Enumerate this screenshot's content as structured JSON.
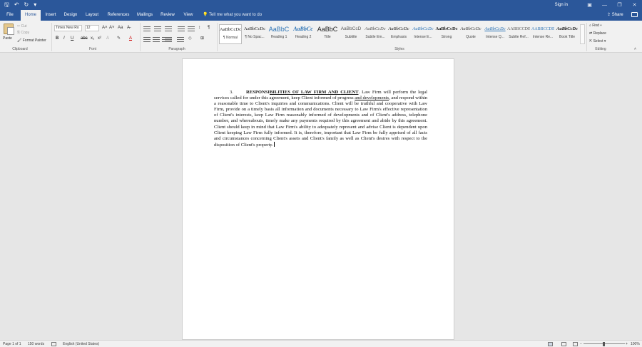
{
  "qat": {
    "save_icon": "save-icon",
    "undo_icon": "undo-icon",
    "redo_icon": "redo-icon"
  },
  "window": {
    "signin": "Sign in",
    "min": "—",
    "restore": "❐",
    "close": "✕"
  },
  "tabs": [
    "File",
    "Home",
    "Insert",
    "Design",
    "Layout",
    "References",
    "Mailings",
    "Review",
    "View"
  ],
  "tell_me": "Tell me what you want to do",
  "share": "Share",
  "clipboard": {
    "paste": "Paste",
    "cut": "Cut",
    "copy": "Copy",
    "format_painter": "Format Painter",
    "group": "Clipboard"
  },
  "font": {
    "family": "Times New Ro",
    "size": "12",
    "group": "Font",
    "grow": "A˄",
    "shrink": "A˅",
    "case": "Aa",
    "bold": "B",
    "italic": "I",
    "underline": "U",
    "strike": "abc",
    "sub": "x₂",
    "sup": "x²",
    "color": "A"
  },
  "paragraph": {
    "group": "Paragraph",
    "pilcrow": "¶"
  },
  "styles": {
    "group": "Styles",
    "items": [
      {
        "preview": "AaBbCcDc",
        "name": "¶ Normal"
      },
      {
        "preview": "AaBbCcDc",
        "name": "¶ No Spac..."
      },
      {
        "preview": "AaBbC",
        "name": "Heading 1"
      },
      {
        "preview": "AaBbCc",
        "name": "Heading 2"
      },
      {
        "preview": "AaBbC",
        "name": "Title"
      },
      {
        "preview": "AaBbCcD",
        "name": "Subtitle"
      },
      {
        "preview": "AaBbCcDc",
        "name": "Subtle Em..."
      },
      {
        "preview": "AaBbCcDc",
        "name": "Emphasis"
      },
      {
        "preview": "AaBbCcDc",
        "name": "Intense E..."
      },
      {
        "preview": "AaBbCcDc",
        "name": "Strong"
      },
      {
        "preview": "AaBbCcDc",
        "name": "Quote"
      },
      {
        "preview": "AaBbCcDc",
        "name": "Intense Q..."
      },
      {
        "preview": "AABBCCDE",
        "name": "Subtle Ref..."
      },
      {
        "preview": "AABBCCDE",
        "name": "Intense Re..."
      },
      {
        "preview": "AaBbCcDc",
        "name": "Book Title"
      }
    ]
  },
  "editing": {
    "find": "Find",
    "replace": "Replace",
    "select": "Select",
    "group": "Editing"
  },
  "document": {
    "number": "3.",
    "heading_part1": "RESPONSI",
    "heading_part2": "BILITIES OF LAW FIRM AND ",
    "heading_part3": "CLIENT",
    "sentence_start": ".  Law Firm will perform the legal services called for under this agreement, keep Client informed of progress ",
    "underlined_phrase": "and developments",
    "body": ", and respond within a reasonable time to Client's inquiries and communications.  Client will be truthful and cooperative with Law Firm, provide on a timely basis all information and documents necessary to Law Firm's effective representation of Client's interests, keep Law Firm reasonably informed of developments and of Client's address, telephone number, and whereabouts, timely make any payments required by this agreement and abide by this agreement.  Client should keep in mind that Law Firm's ability to adequately represent and advise Client is dependent upon Client keeping Law Firm fully informed.  It is, therefore, important that Law Firm be fully apprised of all facts and circumstances concerning Client's assets and Client's family as well as Client's desires with respect to the disposition of Client's property."
  },
  "status": {
    "page": "Page 1 of 1",
    "words": "150 words",
    "language": "English (United States)",
    "zoom": "100%",
    "minus": "−",
    "plus": "+"
  },
  "colors": {
    "accent": "#2b579a",
    "ribbon": "#f1f1f1",
    "canvas": "#e6e6e6"
  }
}
